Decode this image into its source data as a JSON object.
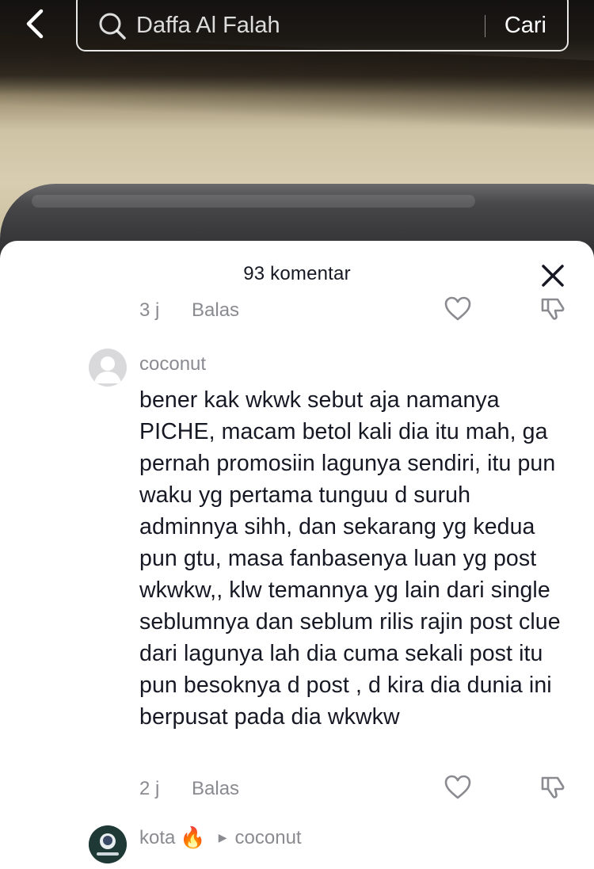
{
  "search": {
    "query": "Daffa Al Falah",
    "submit_label": "Cari"
  },
  "sheet": {
    "title": "93 komentar"
  },
  "comments": [
    {
      "time": "3 j",
      "reply_label": "Balas",
      "partial": true
    },
    {
      "username": "coconut",
      "text": "bener kak wkwk sebut aja namanya PICHE, macam betol kali dia itu mah, ga pernah promosiin lagunya sendiri, itu pun waku yg pertama tunguu d suruh adminnya sihh, dan sekarang yg kedua pun gtu, masa fanbasenya luan yg post wkwkw,, klw temannya yg lain dari single seblumnya dan seblum rilis rajin post clue dari lagunya lah dia cuma sekali post itu pun besoknya d post , d kira dia dunia ini berpusat pada dia wkwkw",
      "time": "2 j",
      "reply_label": "Balas"
    },
    {
      "username": "kota",
      "emoji": "🔥",
      "reply_to": "coconut"
    }
  ],
  "icons": {
    "back": "chevron-left-icon",
    "search": "search-icon",
    "close": "close-icon",
    "like": "heart-outline-icon",
    "dislike": "thumbs-down-outline-icon"
  },
  "colors": {
    "primary_text": "#161823",
    "secondary_text": "#8a8b91",
    "sheet_bg": "#ffffff"
  }
}
